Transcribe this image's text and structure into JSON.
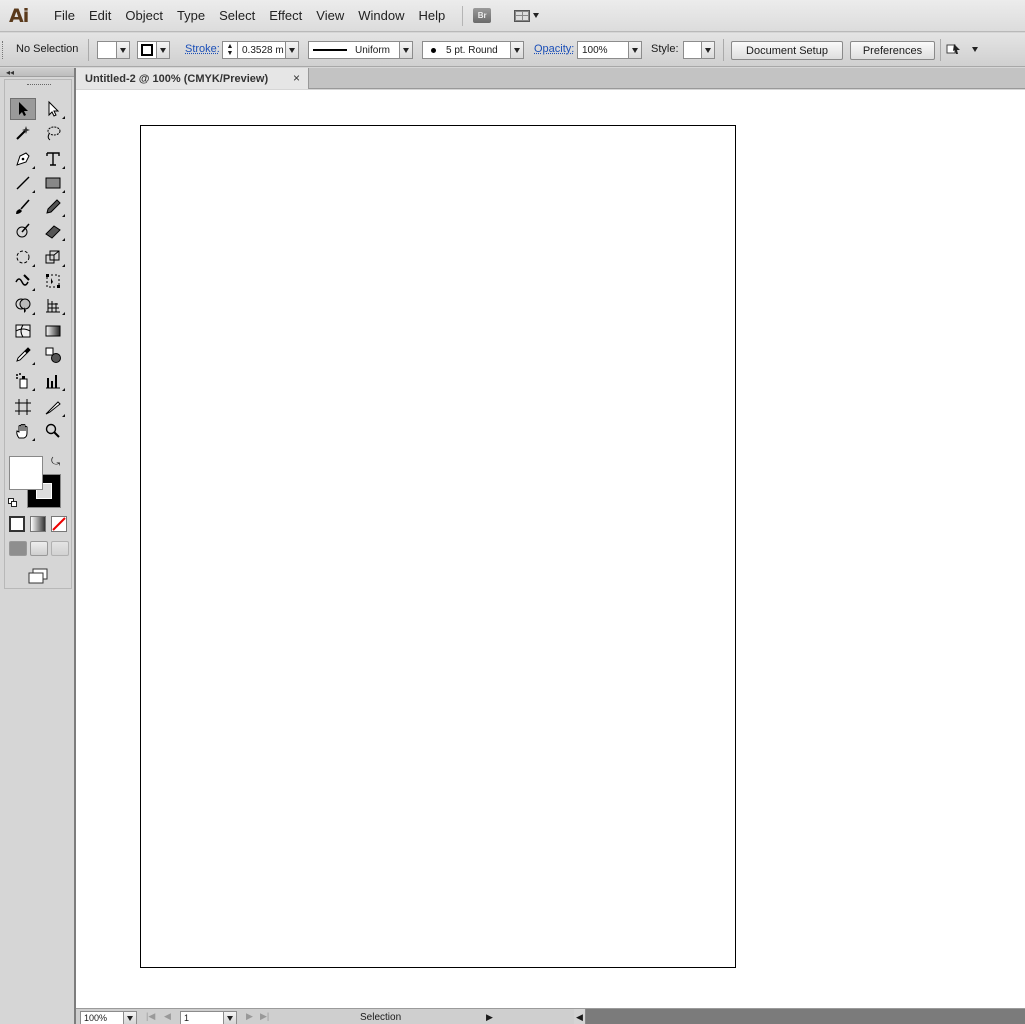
{
  "app": {
    "logo": "Ai"
  },
  "menu": [
    "File",
    "Edit",
    "Object",
    "Type",
    "Select",
    "Effect",
    "View",
    "Window",
    "Help"
  ],
  "bridge_label": "Br",
  "control": {
    "selection": "No Selection",
    "stroke_label": "Stroke:",
    "stroke_value": "0.3528 m",
    "stroke_profile": "Uniform",
    "brush": "5 pt. Round",
    "opacity_label": "Opacity:",
    "opacity_value": "100%",
    "style_label": "Style:",
    "document_setup": "Document Setup",
    "preferences": "Preferences"
  },
  "document": {
    "tab_title": "Untitled-2 @ 100% (CMYK/Preview)",
    "close": "×"
  },
  "status": {
    "zoom": "100%",
    "artboard": "1",
    "tool": "Selection"
  },
  "colors": {
    "accent_link": "#1b4fb8",
    "logo": "#5a3a1c",
    "fill": "#ffffff",
    "stroke": "#000000"
  },
  "icons": {
    "tools": [
      "selection-tool",
      "direct-selection-tool",
      "magic-wand-tool",
      "lasso-tool",
      "pen-tool",
      "type-tool",
      "line-tool",
      "rectangle-tool",
      "paintbrush-tool",
      "pencil-tool",
      "blob-brush-tool",
      "eraser-tool",
      "rotate-tool",
      "scale-tool",
      "warp-tool",
      "free-transform-tool",
      "symbol-sprayer-tool",
      "column-graph-tool",
      "mesh-tool",
      "gradient-tool",
      "eyedropper-tool",
      "live-paint-bucket-tool",
      "shape-builder-tool",
      "graph-tool",
      "artboard-tool",
      "slice-tool",
      "hand-tool",
      "zoom-tool"
    ]
  }
}
